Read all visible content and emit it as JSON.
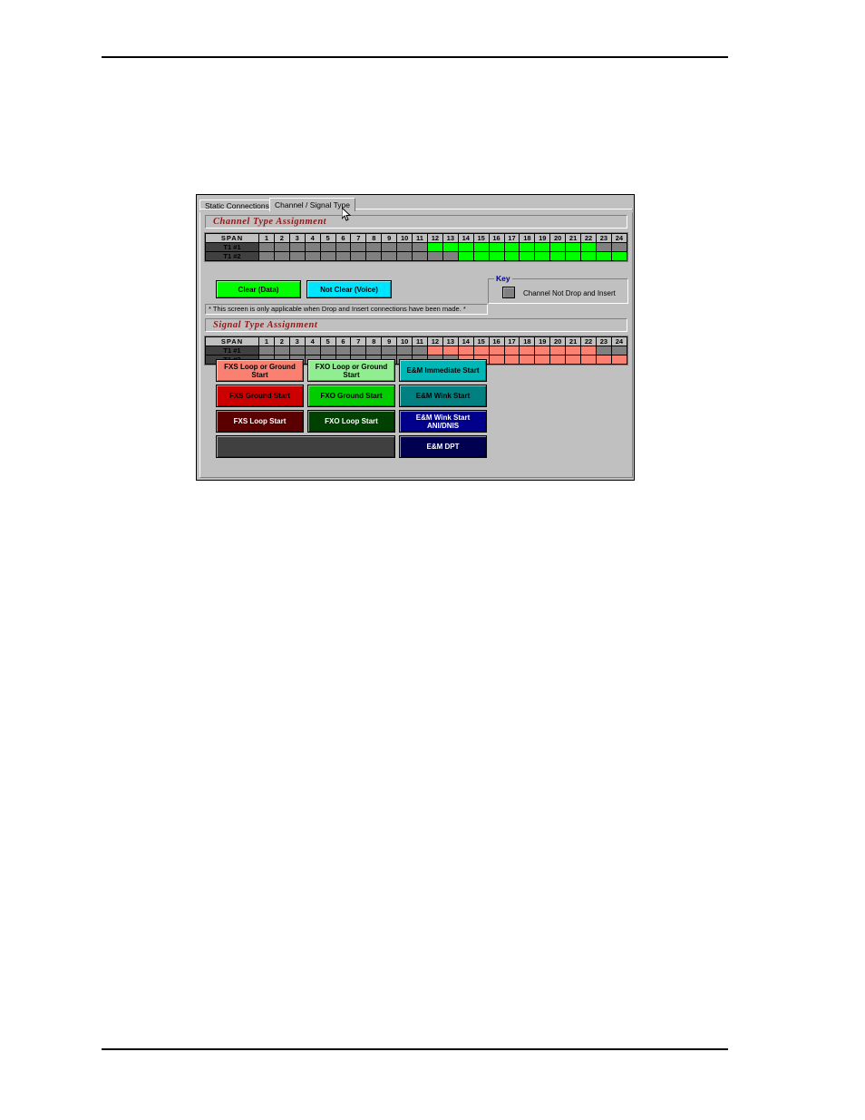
{
  "document": {
    "has_top_rule": true,
    "has_bottom_rule": true
  },
  "dialog": {
    "tabs": [
      {
        "label": "Static Connections",
        "active": false
      },
      {
        "label": "Channel / Signal Type",
        "active": true
      }
    ],
    "channel_section": {
      "title": "Channel Type Assignment",
      "grid": {
        "span_header": "SPAN",
        "columns": [
          "1",
          "2",
          "3",
          "4",
          "5",
          "6",
          "7",
          "8",
          "9",
          "10",
          "11",
          "12",
          "13",
          "14",
          "15",
          "16",
          "17",
          "18",
          "19",
          "20",
          "21",
          "22",
          "23",
          "24"
        ],
        "rows": [
          {
            "label": "T1 #1",
            "states": [
              "off",
              "off",
              "off",
              "off",
              "off",
              "off",
              "off",
              "off",
              "off",
              "off",
              "off",
              "on",
              "on",
              "on",
              "on",
              "on",
              "on",
              "on",
              "on",
              "on",
              "on",
              "on",
              "off",
              "off"
            ]
          },
          {
            "label": "T1 #2",
            "states": [
              "off",
              "off",
              "off",
              "off",
              "off",
              "off",
              "off",
              "off",
              "off",
              "off",
              "off",
              "off",
              "off",
              "on",
              "on",
              "on",
              "on",
              "on",
              "on",
              "on",
              "on",
              "on",
              "on",
              "on"
            ]
          }
        ],
        "on_color": "#00ff00",
        "off_color": "#808080"
      },
      "buttons": [
        {
          "label": "Clear (Data)",
          "bg": "#00ff00",
          "fg": "#000000"
        },
        {
          "label": "Not Clear (Voice)",
          "bg": "#00e5ff",
          "fg": "#000000"
        }
      ],
      "key": {
        "legend": "Key",
        "swatch_color": "#808080",
        "text": "Channel Not Drop and Insert"
      },
      "note": "* This screen is only applicable when Drop and Insert connections have been made. *"
    },
    "signal_section": {
      "title": "Signal Type Assignment",
      "grid": {
        "span_header": "SPAN",
        "columns": [
          "1",
          "2",
          "3",
          "4",
          "5",
          "6",
          "7",
          "8",
          "9",
          "10",
          "11",
          "12",
          "13",
          "14",
          "15",
          "16",
          "17",
          "18",
          "19",
          "20",
          "21",
          "22",
          "23",
          "24"
        ],
        "rows": [
          {
            "label": "T1 #1",
            "states": [
              "off",
              "off",
              "off",
              "off",
              "off",
              "off",
              "off",
              "off",
              "off",
              "off",
              "off",
              "on",
              "on",
              "on",
              "on",
              "on",
              "on",
              "on",
              "on",
              "on",
              "on",
              "on",
              "off",
              "off"
            ]
          },
          {
            "label": "T1 #2",
            "states": [
              "off",
              "off",
              "off",
              "off",
              "off",
              "off",
              "off",
              "off",
              "off",
              "off",
              "off",
              "off",
              "off",
              "on",
              "on",
              "on",
              "on",
              "on",
              "on",
              "on",
              "on",
              "on",
              "on",
              "on"
            ]
          }
        ],
        "on_color": "#fa8072",
        "off_color": "#808080"
      },
      "palette": [
        {
          "label": "FXS Loop or Ground Start",
          "bg": "#fa8072",
          "fg": "#000000",
          "col": 0,
          "row": 0
        },
        {
          "label": "FXO Loop or Ground Start",
          "bg": "#90ee90",
          "fg": "#000000",
          "col": 1,
          "row": 0
        },
        {
          "label": "E&M Immediate Start",
          "bg": "#00b7b7",
          "fg": "#000000",
          "col": 2,
          "row": 0
        },
        {
          "label": "FXS Ground Start",
          "bg": "#cc0000",
          "fg": "#000000",
          "col": 0,
          "row": 1
        },
        {
          "label": "FXO Ground Start",
          "bg": "#00cc00",
          "fg": "#000000",
          "col": 1,
          "row": 1
        },
        {
          "label": "E&M Wink Start",
          "bg": "#008080",
          "fg": "#000000",
          "col": 2,
          "row": 1
        },
        {
          "label": "FXS Loop Start",
          "bg": "#5a0000",
          "fg": "#ffffff",
          "col": 0,
          "row": 2
        },
        {
          "label": "FXO Loop Start",
          "bg": "#004000",
          "fg": "#ffffff",
          "col": 1,
          "row": 2
        },
        {
          "label": "E&M Wink Start ANI/DNIS",
          "bg": "#00008b",
          "fg": "#ffffff",
          "col": 2,
          "row": 2
        },
        {
          "label": "",
          "bg": "#404040",
          "fg": "#ffffff",
          "col": 0,
          "row": 3,
          "wide": true
        },
        {
          "label": "E&M DPT",
          "bg": "#000050",
          "fg": "#ffffff",
          "col": 2,
          "row": 3
        }
      ]
    }
  }
}
